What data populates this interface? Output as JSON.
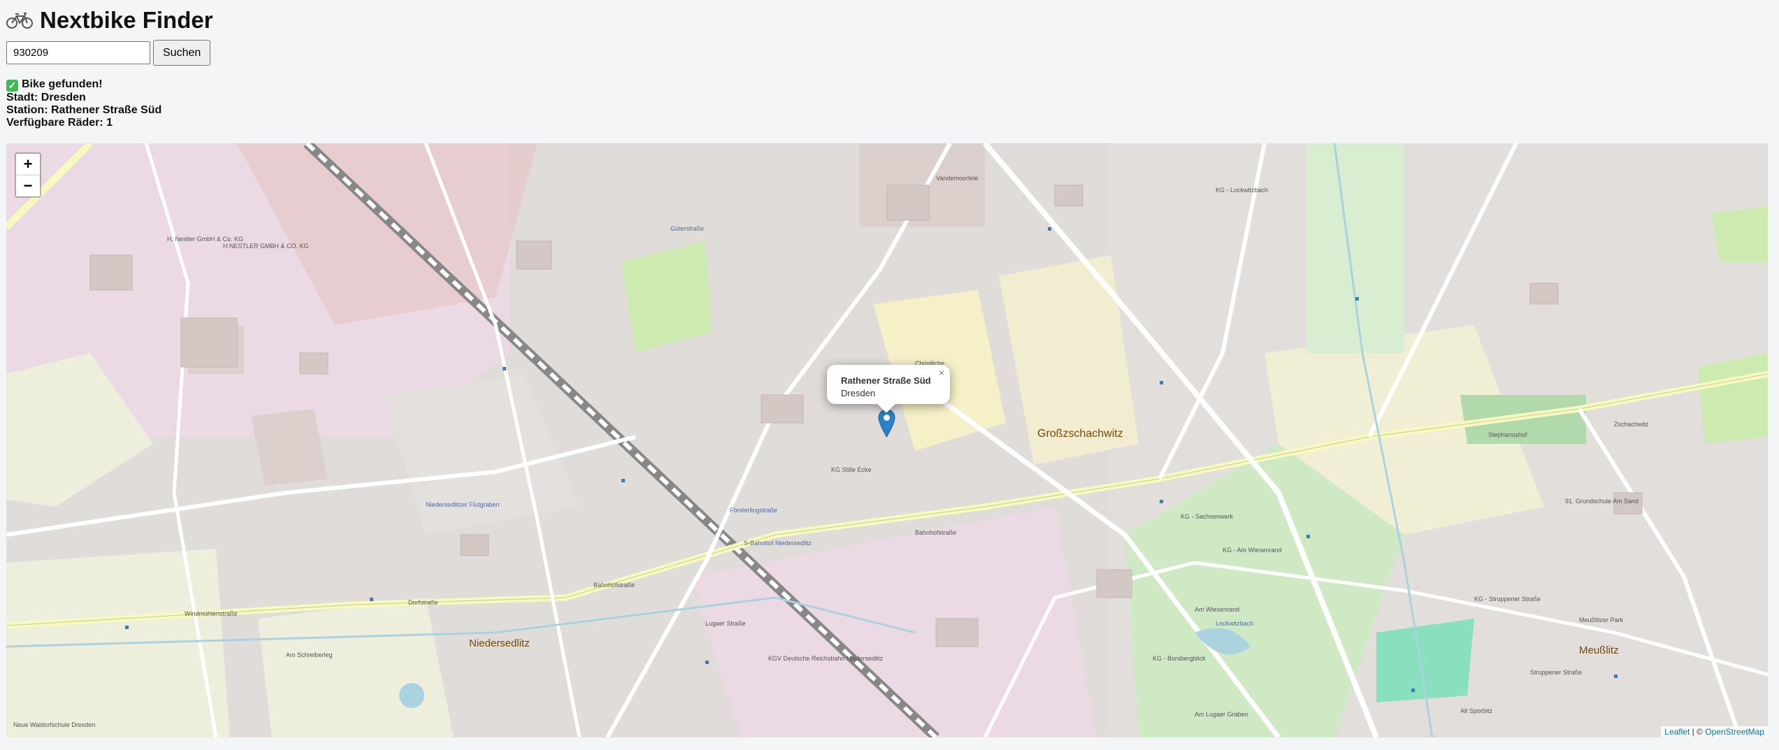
{
  "app": {
    "title": "Nextbike Finder",
    "icon": "bicycle-icon"
  },
  "search": {
    "value": "930209",
    "button_label": "Suchen"
  },
  "result": {
    "status": "Bike gefunden!",
    "status_icon": "check-mark-icon",
    "city": "Stadt: Dresden",
    "station": "Station: Rathener Straße Süd",
    "available": "Verfügbare Räder: 1"
  },
  "map": {
    "zoom_in": "+",
    "zoom_out": "−",
    "popup": {
      "title": "Rathener Straße Süd",
      "subtitle": "Dresden",
      "close": "×"
    },
    "attribution": {
      "leaflet": "Leaflet",
      "separator": " | © ",
      "osm": "OpenStreetMap"
    },
    "labels": {
      "l1": "Großzschachwitz",
      "l2": "Niedersedlitz",
      "l3": "Meußlitz",
      "l4": "KG - Lockwitzbach",
      "l5": "H. Nestler GmbH & Co. KG",
      "l6": "H.NESTLER GMBH & CO. KG",
      "l7": "Vandemoortele",
      "l8": "Christliche",
      "l9": "Güterstraße",
      "l10": "Försterlingstraße",
      "l11": "S-Bahnhof Niedersedlitz",
      "l12": "Bahnhofstraße",
      "l13": "Stephanushof",
      "l14": "91. Grundschule Am Sand",
      "l15": "Meußlitzer Park",
      "l16": "KG - Am Wiesenrand",
      "l17": "KG - Sachsenwerk",
      "l18": "KG Stille Ecke",
      "l19": "Windmühlenstraße",
      "l20": "Dorfstraße",
      "l21": "Lugaer Straße",
      "l22": "Zschachwitz",
      "l23": "KG - Borsbergblick",
      "l24": "Am Lugaer Graben",
      "l25": "Niedersedlitzer Flutgraben",
      "l26": "Neue Waldorfschule Dresden",
      "l27": "Am Schreiberleg",
      "l28": "KGV Deutsche Reichsbahn Niedersedlitz",
      "l29": "Alt Sporbitz",
      "l30": "KG - Struppener Straße",
      "l31": "Am Wiesenrand",
      "l32": "Lockwitzbach",
      "l33": "Struppener Straße",
      "l34": "Bahnhofstraße"
    }
  },
  "colors": {
    "page_bg": "#f4f5f7",
    "marker": "#2a81cb",
    "leaflet_link": "#0078a8"
  }
}
